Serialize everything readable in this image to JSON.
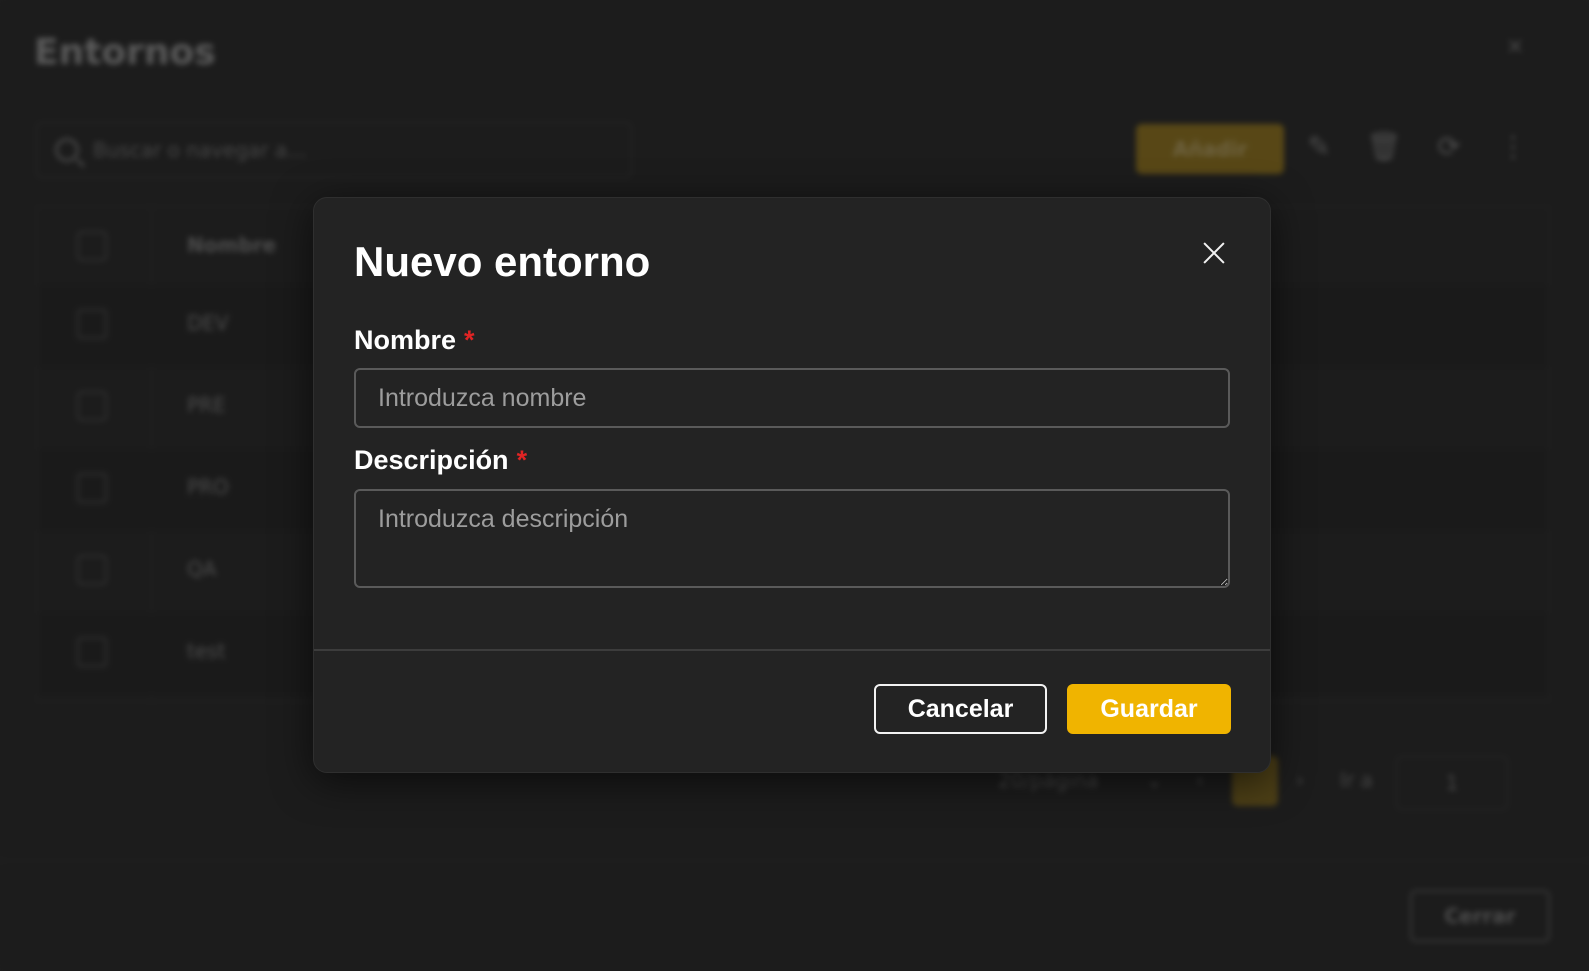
{
  "background": {
    "title": "Entornos",
    "close_icon": "×",
    "search_placeholder": "Buscar o navegar a...",
    "add_button": "Añadir",
    "table": {
      "header": "Nombre",
      "rows": [
        "DEV",
        "PRE",
        "PRO",
        "QA",
        "test"
      ]
    },
    "pager": {
      "page_size": "20/página",
      "current_page": "1",
      "goto_label": "Ir a",
      "goto_value": "1"
    },
    "close_button": "Cerrar"
  },
  "modal": {
    "title": "Nuevo entorno",
    "fields": {
      "name": {
        "label": "Nombre",
        "required_mark": "*",
        "placeholder": "Introduzca nombre",
        "value": ""
      },
      "description": {
        "label": "Descripción",
        "required_mark": "*",
        "placeholder": "Introduzca descripción",
        "value": ""
      }
    },
    "cancel_label": "Cancelar",
    "save_label": "Guardar"
  },
  "colors": {
    "accent": "#f0b400",
    "required": "#e02424",
    "background": "#232323"
  }
}
